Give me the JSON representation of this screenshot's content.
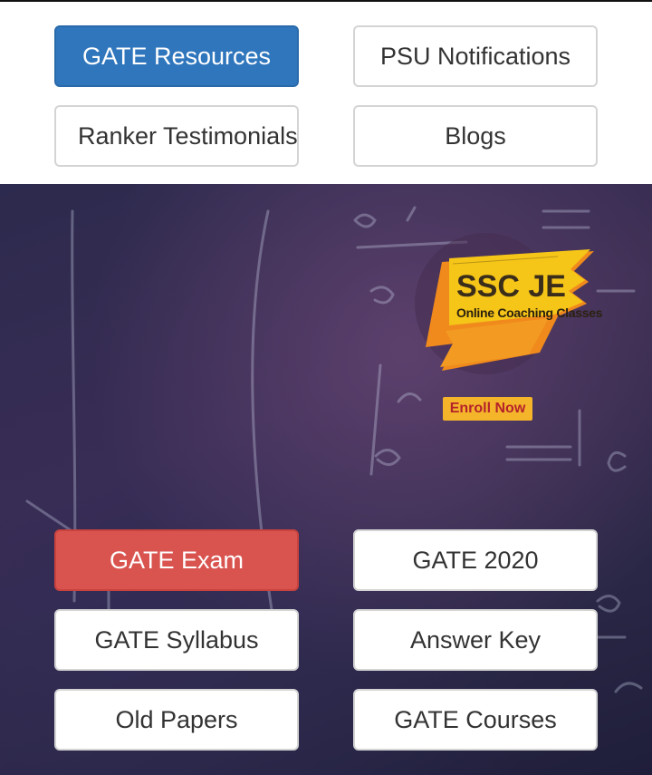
{
  "top_nav": {
    "gate_resources": "GATE Resources",
    "psu_notifications": "PSU Notifications",
    "ranker_testimonials": "Ranker Testimonials",
    "blogs": "Blogs"
  },
  "promo": {
    "title": "SSC JE",
    "subtitle": "Online Coaching Classes",
    "cta": "Enroll Now"
  },
  "links": {
    "gate_exam": "GATE Exam",
    "gate_2020": "GATE 2020",
    "gate_syllabus": "GATE Syllabus",
    "answer_key": "Answer Key",
    "old_papers": "Old Papers",
    "gate_courses": "GATE Courses"
  },
  "colors": {
    "primary": "#2f76bd",
    "danger": "#d9534f",
    "promo_yellow": "#f5c518",
    "promo_orange": "#f08a1c"
  }
}
